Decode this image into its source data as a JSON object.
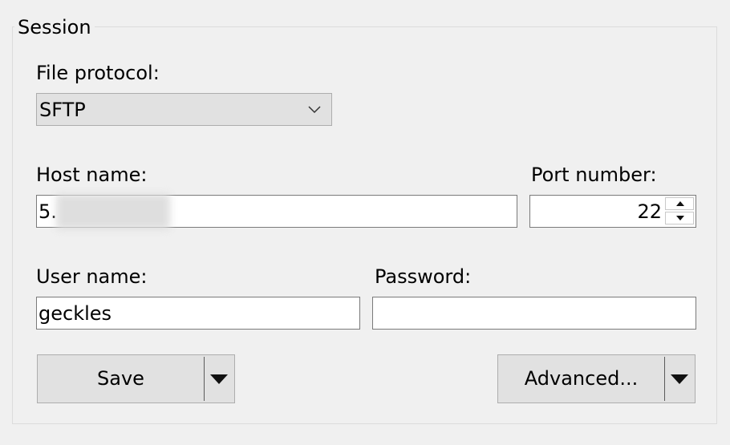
{
  "session": {
    "group_title": "Session"
  },
  "protocol": {
    "label": "File protocol:",
    "selected": "SFTP"
  },
  "host": {
    "label": "Host name:",
    "value_visible": "5."
  },
  "port": {
    "label": "Port number:",
    "value": "22"
  },
  "user": {
    "label": "User name:",
    "value": "geckles"
  },
  "password": {
    "label": "Password:",
    "value": ""
  },
  "buttons": {
    "save_label": "Save",
    "advanced_label": "Advanced..."
  },
  "icons": {
    "combo": "chevron-down-icon",
    "spin_up": "spin-up-arrow-icon",
    "spin_down": "spin-down-arrow-icon",
    "dropdown": "dropdown-arrow-icon"
  }
}
